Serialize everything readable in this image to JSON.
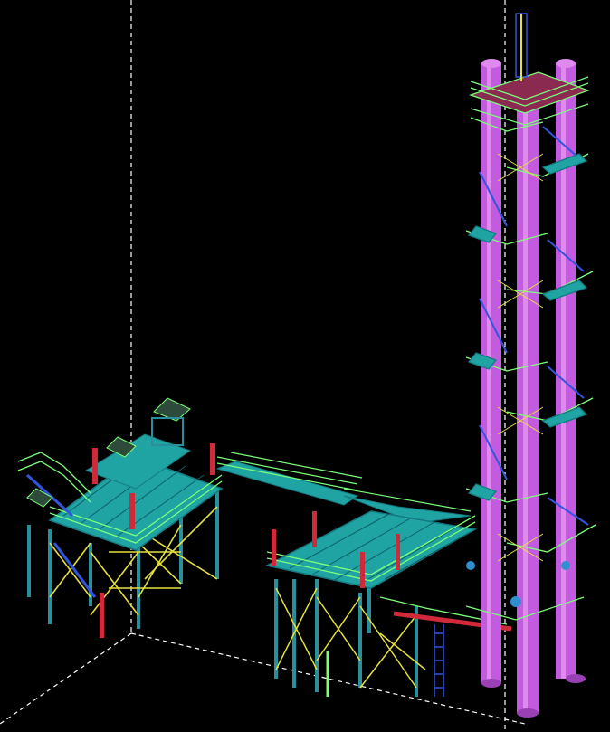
{
  "viewport": {
    "background": "#000000",
    "view_mode": "wireframe-3d"
  },
  "palette": {
    "deck": "#1fa3a3",
    "deck_dark": "#147a80",
    "rail_green": "#7cff7a",
    "rail_yellow": "#f2f25a",
    "brace_yellow": "#e6e040",
    "leg_teal": "#2a8f9a",
    "leg_blue": "#2f5fd0",
    "pillar_magenta": "#c35be0",
    "pillar_light": "#e08af0",
    "beam_red": "#d02a3a",
    "stair_blue": "#3355dd",
    "axis_white": "#ffffff"
  },
  "objects": [
    "left-platform",
    "middle-walkway",
    "right-platform",
    "four-pillar-tower",
    "ladder-cage",
    "spiral-stairs"
  ]
}
